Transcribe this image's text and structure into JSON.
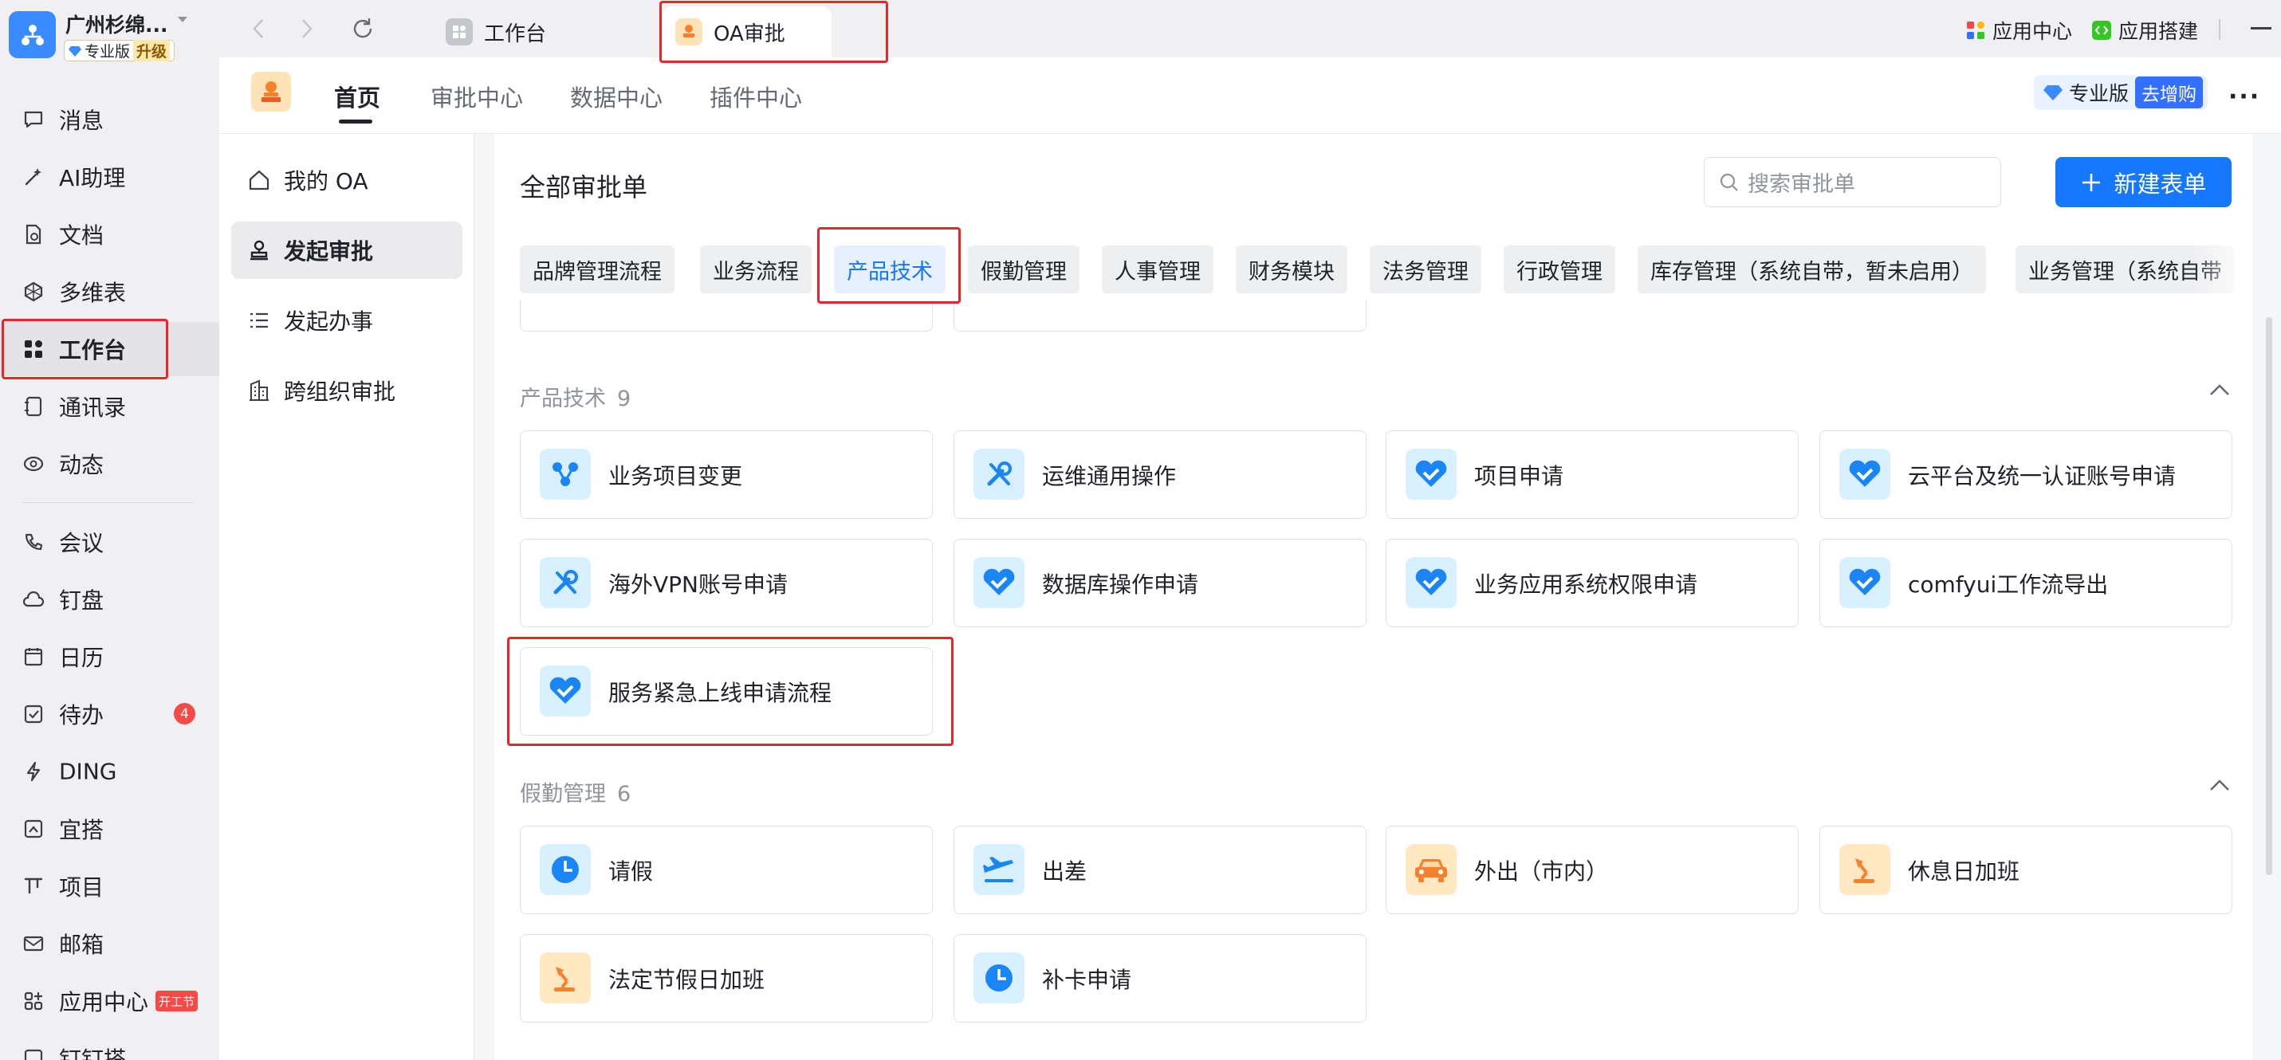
{
  "org": {
    "name": "广州杉绵...",
    "edition": "专业版",
    "upgrade": "升级"
  },
  "sidebar": {
    "items": [
      {
        "label": "消息",
        "icon": "message-icon"
      },
      {
        "label": "AI助理",
        "icon": "ai-assistant-icon"
      },
      {
        "label": "文档",
        "icon": "document-icon"
      },
      {
        "label": "多维表",
        "icon": "multi-table-icon"
      },
      {
        "label": "工作台",
        "icon": "workbench-icon"
      },
      {
        "label": "通讯录",
        "icon": "contacts-icon"
      },
      {
        "label": "动态",
        "icon": "moments-icon"
      },
      {
        "label": "会议",
        "icon": "meeting-icon"
      },
      {
        "label": "钉盘",
        "icon": "cloud-disk-icon"
      },
      {
        "label": "日历",
        "icon": "calendar-icon"
      },
      {
        "label": "待办",
        "icon": "todo-icon",
        "badge": "4"
      },
      {
        "label": "DING",
        "icon": "ding-icon"
      },
      {
        "label": "宜搭",
        "icon": "yida-icon"
      },
      {
        "label": "项目",
        "icon": "project-icon"
      },
      {
        "label": "邮箱",
        "icon": "mail-icon"
      },
      {
        "label": "应用中心",
        "icon": "app-center-icon",
        "badge": "开工节"
      },
      {
        "label": "钉钉搭",
        "icon": "dingtalk-builder-icon"
      }
    ],
    "active": "工作台"
  },
  "topbar": {
    "tabs": [
      {
        "label": "工作台"
      },
      {
        "label": "OA审批"
      }
    ],
    "active_tab": "OA审批",
    "right": {
      "app_center": "应用中心",
      "app_build": "应用搭建"
    }
  },
  "app": {
    "tabs": [
      "首页",
      "审批中心",
      "数据中心",
      "插件中心"
    ],
    "active_tab": "首页",
    "pro_label": "专业版",
    "pro_buy": "去增购",
    "more": "···"
  },
  "oa_nav": {
    "items": [
      {
        "label": "我的 OA",
        "icon": "home-icon"
      },
      {
        "label": "发起审批",
        "icon": "stamp-icon"
      },
      {
        "label": "发起办事",
        "icon": "list-icon"
      },
      {
        "label": "跨组织审批",
        "icon": "building-icon"
      }
    ],
    "active": "发起审批"
  },
  "main": {
    "title": "全部审批单",
    "search_placeholder": "搜索审批单",
    "new_button": "新建表单",
    "categories": [
      "品牌管理流程",
      "业务流程",
      "产品技术",
      "假勤管理",
      "人事管理",
      "财务模块",
      "法务管理",
      "行政管理",
      "库存管理（系统自带，暂未启用）",
      "业务管理（系统自带"
    ],
    "active_category": "产品技术",
    "sections": [
      {
        "name": "产品技术",
        "count": "9",
        "forms": [
          {
            "label": "业务项目变更",
            "icon": "share-nodes-icon",
            "tone": "blue"
          },
          {
            "label": "运维通用操作",
            "icon": "wrench-icon",
            "tone": "blue"
          },
          {
            "label": "项目申请",
            "icon": "heart-check-icon",
            "tone": "blue"
          },
          {
            "label": "云平台及统一认证账号申请",
            "icon": "heart-check-icon",
            "tone": "blue"
          },
          {
            "label": "海外VPN账号申请",
            "icon": "wrench-icon",
            "tone": "blue"
          },
          {
            "label": "数据库操作申请",
            "icon": "heart-check-icon",
            "tone": "blue"
          },
          {
            "label": "业务应用系统权限申请",
            "icon": "heart-check-icon",
            "tone": "blue"
          },
          {
            "label": "comfyui工作流导出",
            "icon": "heart-check-icon",
            "tone": "blue"
          },
          {
            "label": "服务紧急上线申请流程",
            "icon": "heart-check-icon",
            "tone": "blue"
          }
        ]
      },
      {
        "name": "假勤管理",
        "count": "6",
        "forms": [
          {
            "label": "请假",
            "icon": "clock-icon",
            "tone": "blue"
          },
          {
            "label": "出差",
            "icon": "plane-icon",
            "tone": "blue"
          },
          {
            "label": "外出（市内）",
            "icon": "car-icon",
            "tone": "orange"
          },
          {
            "label": "休息日加班",
            "icon": "desk-lamp-icon",
            "tone": "orange"
          },
          {
            "label": "法定节假日加班",
            "icon": "desk-lamp-icon",
            "tone": "orange"
          },
          {
            "label": "补卡申请",
            "icon": "clock-icon",
            "tone": "blue"
          }
        ]
      }
    ]
  },
  "colors": {
    "accent": "#1677ff",
    "highlight": "#e8262a",
    "badge": "#f54a45"
  }
}
